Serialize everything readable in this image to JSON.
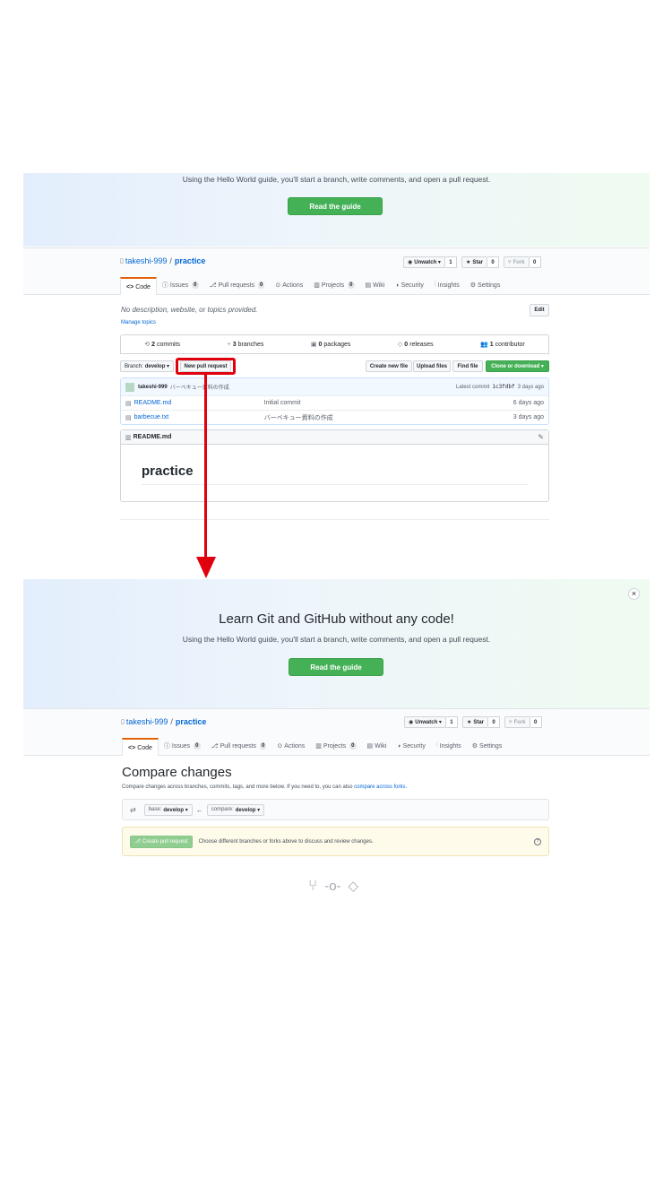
{
  "top": {
    "hero": {
      "subtitle": "Using the Hello World guide, you'll start a branch, write comments, and open a pull request.",
      "guide_button": "Read the guide"
    },
    "repo": {
      "owner": "takeshi-999",
      "sep": "/",
      "name": "practice"
    },
    "actions": {
      "unwatch": "Unwatch ▾",
      "unwatch_count": "1",
      "star": "Star",
      "star_count": "0",
      "fork": "Fork",
      "fork_count": "0"
    },
    "tabs": [
      {
        "label": "Code",
        "count": ""
      },
      {
        "label": "Issues",
        "count": "0"
      },
      {
        "label": "Pull requests",
        "count": "0"
      },
      {
        "label": "Actions",
        "count": ""
      },
      {
        "label": "Projects",
        "count": "0"
      },
      {
        "label": "Wiki",
        "count": ""
      },
      {
        "label": "Security",
        "count": ""
      },
      {
        "label": "Insights",
        "count": ""
      },
      {
        "label": "Settings",
        "count": ""
      }
    ],
    "description": "No description, website, or topics provided.",
    "manage_topics": "Manage topics",
    "edit": "Edit",
    "stats": {
      "commits_num": "2",
      "commits_label": "commits",
      "branches_num": "3",
      "branches_label": "branches",
      "packages_num": "0",
      "packages_label": "packages",
      "releases_num": "0",
      "releases_label": "releases",
      "contrib_num": "1",
      "contrib_label": "contributor"
    },
    "toolbar": {
      "branch_label": "Branch:",
      "branch_value": "develop ▾",
      "new_pr": "New pull request",
      "create_file": "Create new file",
      "upload": "Upload files",
      "find": "Find file",
      "clone": "Clone or download ▾"
    },
    "commit_bar": {
      "user": "takeshi-999",
      "message": "バーベキュー資料の作成",
      "latest_label": "Latest commit",
      "sha": "1c3fdbf",
      "time": "3 days ago"
    },
    "files": [
      {
        "name": "README.md",
        "message": "Initial commit",
        "time": "6 days ago"
      },
      {
        "name": "barbecue.txt",
        "message": "バーベキュー資料の作成",
        "time": "3 days ago"
      }
    ],
    "readme": {
      "header": "README.md",
      "heading": "practice"
    }
  },
  "bottom": {
    "hero": {
      "title": "Learn Git and GitHub without any code!",
      "subtitle": "Using the Hello World guide, you'll start a branch, write comments, and open a pull request.",
      "guide_button": "Read the guide",
      "close": "×"
    },
    "compare": {
      "title": "Compare changes",
      "desc": "Compare changes across branches, commits, tags, and more below. If you need to, you can also",
      "desc_link": "compare across forks.",
      "base_label": "base:",
      "base_value": "develop ▾",
      "arrow": "←",
      "compare_label": "compare:",
      "compare_value": "develop ▾",
      "create_pr": "Create pull request",
      "hint": "Choose different branches or forks above to discuss and review changes.",
      "help": "?"
    }
  },
  "colors": {
    "green": "#45b156",
    "link": "#0366d6",
    "highlight": "#e0000e",
    "warn_bg": "#fffbea"
  }
}
